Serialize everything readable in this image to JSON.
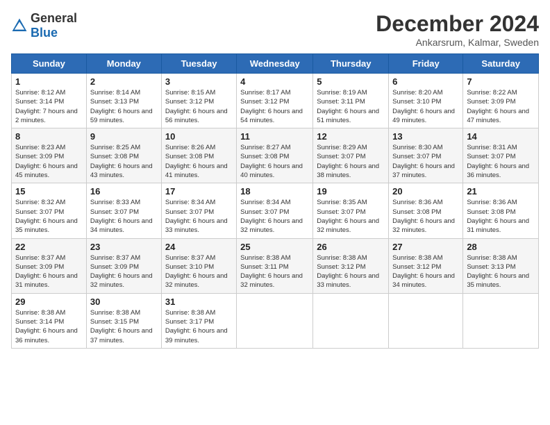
{
  "header": {
    "logo": {
      "text_general": "General",
      "text_blue": "Blue"
    },
    "month": "December 2024",
    "location": "Ankarsrum, Kalmar, Sweden"
  },
  "days_of_week": [
    "Sunday",
    "Monday",
    "Tuesday",
    "Wednesday",
    "Thursday",
    "Friday",
    "Saturday"
  ],
  "weeks": [
    [
      {
        "day": 1,
        "sunrise": "8:12 AM",
        "sunset": "3:14 PM",
        "daylight": "7 hours and 2 minutes."
      },
      {
        "day": 2,
        "sunrise": "8:14 AM",
        "sunset": "3:13 PM",
        "daylight": "6 hours and 59 minutes."
      },
      {
        "day": 3,
        "sunrise": "8:15 AM",
        "sunset": "3:12 PM",
        "daylight": "6 hours and 56 minutes."
      },
      {
        "day": 4,
        "sunrise": "8:17 AM",
        "sunset": "3:12 PM",
        "daylight": "6 hours and 54 minutes."
      },
      {
        "day": 5,
        "sunrise": "8:19 AM",
        "sunset": "3:11 PM",
        "daylight": "6 hours and 51 minutes."
      },
      {
        "day": 6,
        "sunrise": "8:20 AM",
        "sunset": "3:10 PM",
        "daylight": "6 hours and 49 minutes."
      },
      {
        "day": 7,
        "sunrise": "8:22 AM",
        "sunset": "3:09 PM",
        "daylight": "6 hours and 47 minutes."
      }
    ],
    [
      {
        "day": 8,
        "sunrise": "8:23 AM",
        "sunset": "3:09 PM",
        "daylight": "6 hours and 45 minutes."
      },
      {
        "day": 9,
        "sunrise": "8:25 AM",
        "sunset": "3:08 PM",
        "daylight": "6 hours and 43 minutes."
      },
      {
        "day": 10,
        "sunrise": "8:26 AM",
        "sunset": "3:08 PM",
        "daylight": "6 hours and 41 minutes."
      },
      {
        "day": 11,
        "sunrise": "8:27 AM",
        "sunset": "3:08 PM",
        "daylight": "6 hours and 40 minutes."
      },
      {
        "day": 12,
        "sunrise": "8:29 AM",
        "sunset": "3:07 PM",
        "daylight": "6 hours and 38 minutes."
      },
      {
        "day": 13,
        "sunrise": "8:30 AM",
        "sunset": "3:07 PM",
        "daylight": "6 hours and 37 minutes."
      },
      {
        "day": 14,
        "sunrise": "8:31 AM",
        "sunset": "3:07 PM",
        "daylight": "6 hours and 36 minutes."
      }
    ],
    [
      {
        "day": 15,
        "sunrise": "8:32 AM",
        "sunset": "3:07 PM",
        "daylight": "6 hours and 35 minutes."
      },
      {
        "day": 16,
        "sunrise": "8:33 AM",
        "sunset": "3:07 PM",
        "daylight": "6 hours and 34 minutes."
      },
      {
        "day": 17,
        "sunrise": "8:34 AM",
        "sunset": "3:07 PM",
        "daylight": "6 hours and 33 minutes."
      },
      {
        "day": 18,
        "sunrise": "8:34 AM",
        "sunset": "3:07 PM",
        "daylight": "6 hours and 32 minutes."
      },
      {
        "day": 19,
        "sunrise": "8:35 AM",
        "sunset": "3:07 PM",
        "daylight": "6 hours and 32 minutes."
      },
      {
        "day": 20,
        "sunrise": "8:36 AM",
        "sunset": "3:08 PM",
        "daylight": "6 hours and 32 minutes."
      },
      {
        "day": 21,
        "sunrise": "8:36 AM",
        "sunset": "3:08 PM",
        "daylight": "6 hours and 31 minutes."
      }
    ],
    [
      {
        "day": 22,
        "sunrise": "8:37 AM",
        "sunset": "3:09 PM",
        "daylight": "6 hours and 31 minutes."
      },
      {
        "day": 23,
        "sunrise": "8:37 AM",
        "sunset": "3:09 PM",
        "daylight": "6 hours and 32 minutes."
      },
      {
        "day": 24,
        "sunrise": "8:37 AM",
        "sunset": "3:10 PM",
        "daylight": "6 hours and 32 minutes."
      },
      {
        "day": 25,
        "sunrise": "8:38 AM",
        "sunset": "3:11 PM",
        "daylight": "6 hours and 32 minutes."
      },
      {
        "day": 26,
        "sunrise": "8:38 AM",
        "sunset": "3:12 PM",
        "daylight": "6 hours and 33 minutes."
      },
      {
        "day": 27,
        "sunrise": "8:38 AM",
        "sunset": "3:12 PM",
        "daylight": "6 hours and 34 minutes."
      },
      {
        "day": 28,
        "sunrise": "8:38 AM",
        "sunset": "3:13 PM",
        "daylight": "6 hours and 35 minutes."
      }
    ],
    [
      {
        "day": 29,
        "sunrise": "8:38 AM",
        "sunset": "3:14 PM",
        "daylight": "6 hours and 36 minutes."
      },
      {
        "day": 30,
        "sunrise": "8:38 AM",
        "sunset": "3:15 PM",
        "daylight": "6 hours and 37 minutes."
      },
      {
        "day": 31,
        "sunrise": "8:38 AM",
        "sunset": "3:17 PM",
        "daylight": "6 hours and 39 minutes."
      },
      null,
      null,
      null,
      null
    ]
  ]
}
